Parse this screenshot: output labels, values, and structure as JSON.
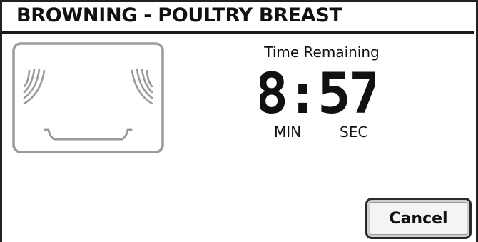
{
  "header": {
    "title": "BROWNING - POULTRY BREAST"
  },
  "timer": {
    "label": "Time Remaining",
    "value": "8:57",
    "minutes_unit": "MIN",
    "seconds_unit": "SEC"
  },
  "actions": {
    "cancel_label": "Cancel"
  },
  "icons": {
    "oven": "oven-broil-icon"
  },
  "colors": {
    "icon_stroke": "#9a9a9a",
    "text": "#111111",
    "border": "#222222"
  }
}
